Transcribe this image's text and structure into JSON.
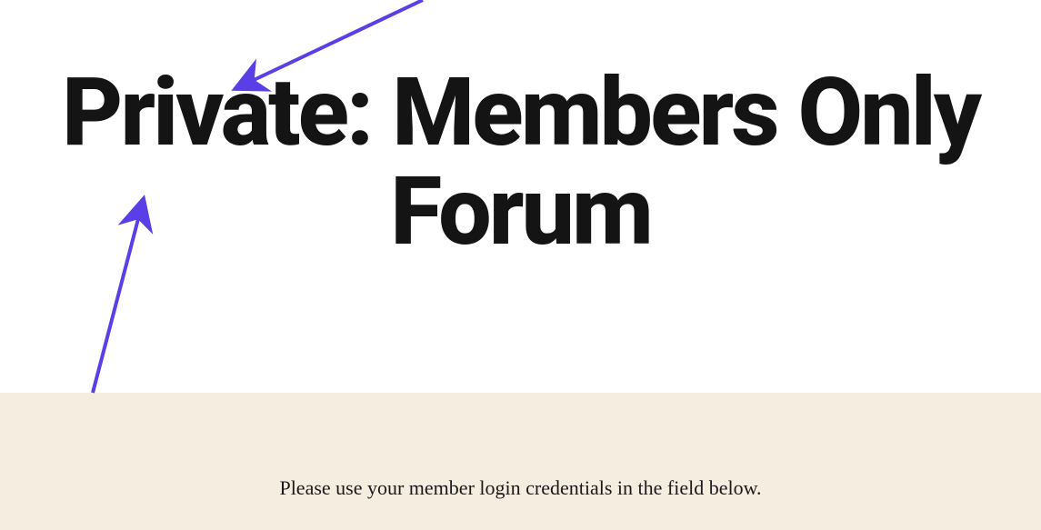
{
  "page": {
    "title": "Private: Members Only Forum",
    "instruction": "Please use your member login credentials in the field below."
  },
  "colors": {
    "arrow": "#5a3ee6",
    "content_bg": "#f4ede0",
    "text": "#141414"
  }
}
